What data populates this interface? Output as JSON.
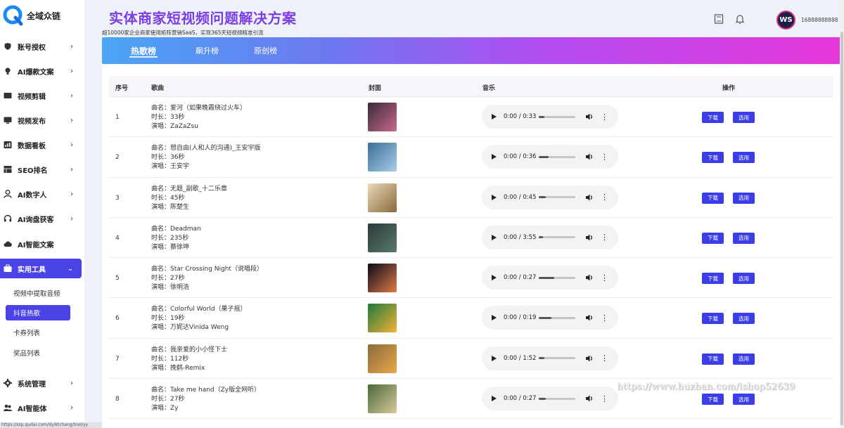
{
  "brand": {
    "name": "全域众链"
  },
  "sidebar": {
    "items": [
      {
        "label": "账号授权",
        "icon": "shield-icon",
        "chevron": "›"
      },
      {
        "label": "AI爆款文案",
        "icon": "bulb-icon",
        "chevron": "›"
      },
      {
        "label": "视频剪辑",
        "icon": "film-icon",
        "chevron": "›"
      },
      {
        "label": "视频发布",
        "icon": "monitor-icon",
        "chevron": "›"
      },
      {
        "label": "数据看板",
        "icon": "chart-icon",
        "chevron": "›"
      },
      {
        "label": "SEO排名",
        "icon": "grid-icon",
        "chevron": "›"
      },
      {
        "label": "AI数字人",
        "icon": "person-icon",
        "chevron": "›"
      },
      {
        "label": "AI询盘获客",
        "icon": "headset-icon",
        "chevron": "›"
      },
      {
        "label": "AI智能文案",
        "icon": "cloud-icon",
        "chevron": ""
      },
      {
        "label": "实用工具",
        "icon": "toolbox-icon",
        "chevron": "⌄"
      },
      {
        "label": "系统管理",
        "icon": "gear-icon",
        "chevron": "›"
      },
      {
        "label": "AI智能体",
        "icon": "people-icon",
        "chevron": "›"
      }
    ],
    "subitems": [
      {
        "label": "视频中提取音频"
      },
      {
        "label": "抖音热歌"
      },
      {
        "label": "卡券列表"
      },
      {
        "label": "奖品列表"
      }
    ]
  },
  "header": {
    "title": "实体商家短视频问题解决方案",
    "subtitle": "超10000家企业商家使用矩阵营销SaaS，实现365天短视频精准引流",
    "username": "16888888888",
    "avatar_text": "WS"
  },
  "tabs": [
    {
      "label": "热歌榜"
    },
    {
      "label": "飙升榜"
    },
    {
      "label": "原创榜"
    }
  ],
  "table": {
    "headers": {
      "index": "序号",
      "song": "歌曲",
      "cover": "封面",
      "music": "音乐",
      "actions": "操作"
    },
    "name_prefix": "曲名：",
    "duration_prefix": "时长：",
    "singer_prefix": "演唱：",
    "download_label": "下载",
    "use_label": "选用",
    "rows": [
      {
        "index": "1",
        "name": "爱河（如果晚霞绕过火车）",
        "duration": "33秒",
        "singer": "ZaZaZsu",
        "time": "0:00 / 0:33",
        "cover_colors": [
          "#3a2a3a",
          "#c86a8a"
        ]
      },
      {
        "index": "2",
        "name": "想自由(人和人的沟通)_王安宇版",
        "duration": "36秒",
        "singer": "王安宇",
        "time": "0:00 / 0:36",
        "cover_colors": [
          "#3b6f9a",
          "#a8cde6"
        ]
      },
      {
        "index": "3",
        "name": "无题_副歌_十二乐章",
        "duration": "45秒",
        "singer": "陈楚生",
        "time": "0:00 / 0:45",
        "cover_colors": [
          "#e9d8b8",
          "#8a6a3a"
        ]
      },
      {
        "index": "4",
        "name": "Deadman",
        "duration": "235秒",
        "singer": "蔡徐坤",
        "time": "0:00 / 3:55",
        "cover_colors": [
          "#2a3a3a",
          "#5a7a6a"
        ]
      },
      {
        "index": "5",
        "name": "Star Crossing Night（说唱段）",
        "duration": "27秒",
        "singer": "徐明浩",
        "time": "0:00 / 0:27",
        "cover_colors": [
          "#0a0a18",
          "#e07a4a"
        ]
      },
      {
        "index": "6",
        "name": "Colorful World（果子摇）",
        "duration": "19秒",
        "singer": "万妮达Vinida Weng",
        "time": "0:00 / 0:19",
        "cover_colors": [
          "#1f7a3a",
          "#f2b23a"
        ]
      },
      {
        "index": "7",
        "name": "我亲爱的小小怪下士",
        "duration": "112秒",
        "singer": "挽鹤-Remix",
        "time": "0:00 / 1:52",
        "cover_colors": [
          "#8a6a3a",
          "#e8a84a"
        ]
      },
      {
        "index": "8",
        "name": "Take me hand（Zy版全网听）",
        "duration": "27秒",
        "singer": "Zy",
        "time": "0:00 / 0:27",
        "cover_colors": [
          "#4a6a3a",
          "#d8c89a"
        ]
      }
    ]
  },
  "watermark": "https://www.huzhan.com/ishop52639",
  "statusbar": "https://ssp.qudai.com/dy/ktchang/tool/yy"
}
